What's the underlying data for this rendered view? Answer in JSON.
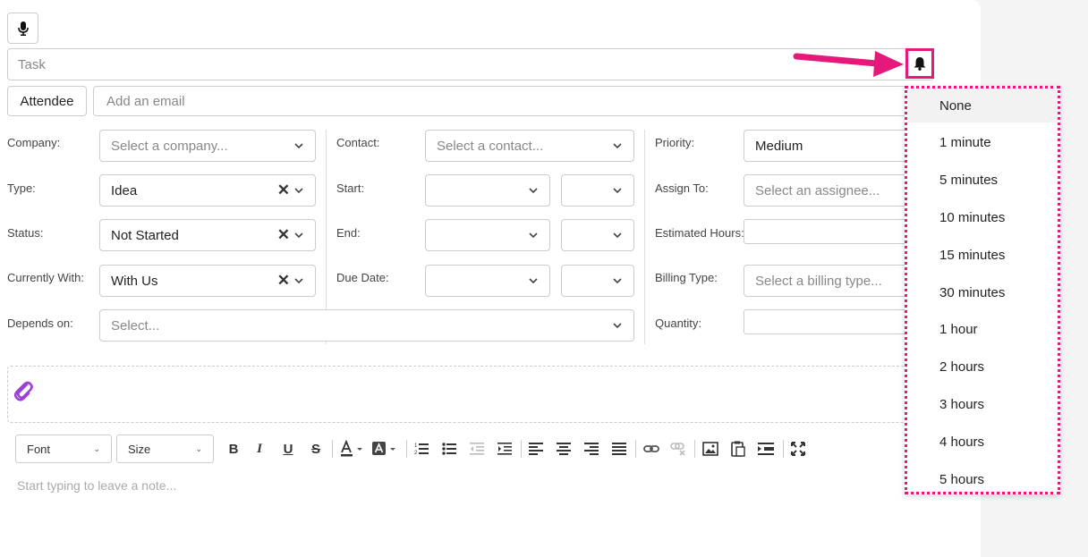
{
  "task": {
    "placeholder": "Task"
  },
  "attendee": {
    "label": "Attendee",
    "email_placeholder": "Add an email"
  },
  "fields": {
    "company": {
      "label": "Company:",
      "placeholder": "Select a company..."
    },
    "contact": {
      "label": "Contact:",
      "placeholder": "Select a contact..."
    },
    "priority": {
      "label": "Priority:",
      "value": "Medium"
    },
    "type": {
      "label": "Type:",
      "value": "Idea"
    },
    "start": {
      "label": "Start:"
    },
    "assign_to": {
      "label": "Assign To:",
      "placeholder": "Select an assignee..."
    },
    "status": {
      "label": "Status:",
      "value": "Not Started"
    },
    "end": {
      "label": "End:"
    },
    "estimated_hours": {
      "label": "Estimated Hours:"
    },
    "currently_with": {
      "label": "Currently With:",
      "value": "With Us"
    },
    "due_date": {
      "label": "Due Date:"
    },
    "billing_type": {
      "label": "Billing Type:",
      "placeholder": "Select a billing type..."
    },
    "depends_on": {
      "label": "Depends on:",
      "placeholder": "Select..."
    },
    "quantity": {
      "label": "Quantity:"
    }
  },
  "toolbar": {
    "font_label": "Font",
    "size_label": "Size"
  },
  "note": {
    "placeholder": "Start typing to leave a note..."
  },
  "reminder_options": [
    "None",
    "1 minute",
    "5 minutes",
    "10 minutes",
    "15 minutes",
    "30 minutes",
    "1 hour",
    "2 hours",
    "3 hours",
    "4 hours",
    "5 hours"
  ],
  "colors": {
    "highlight": "#e4197a",
    "attach_icon": "#9b3fd6"
  }
}
